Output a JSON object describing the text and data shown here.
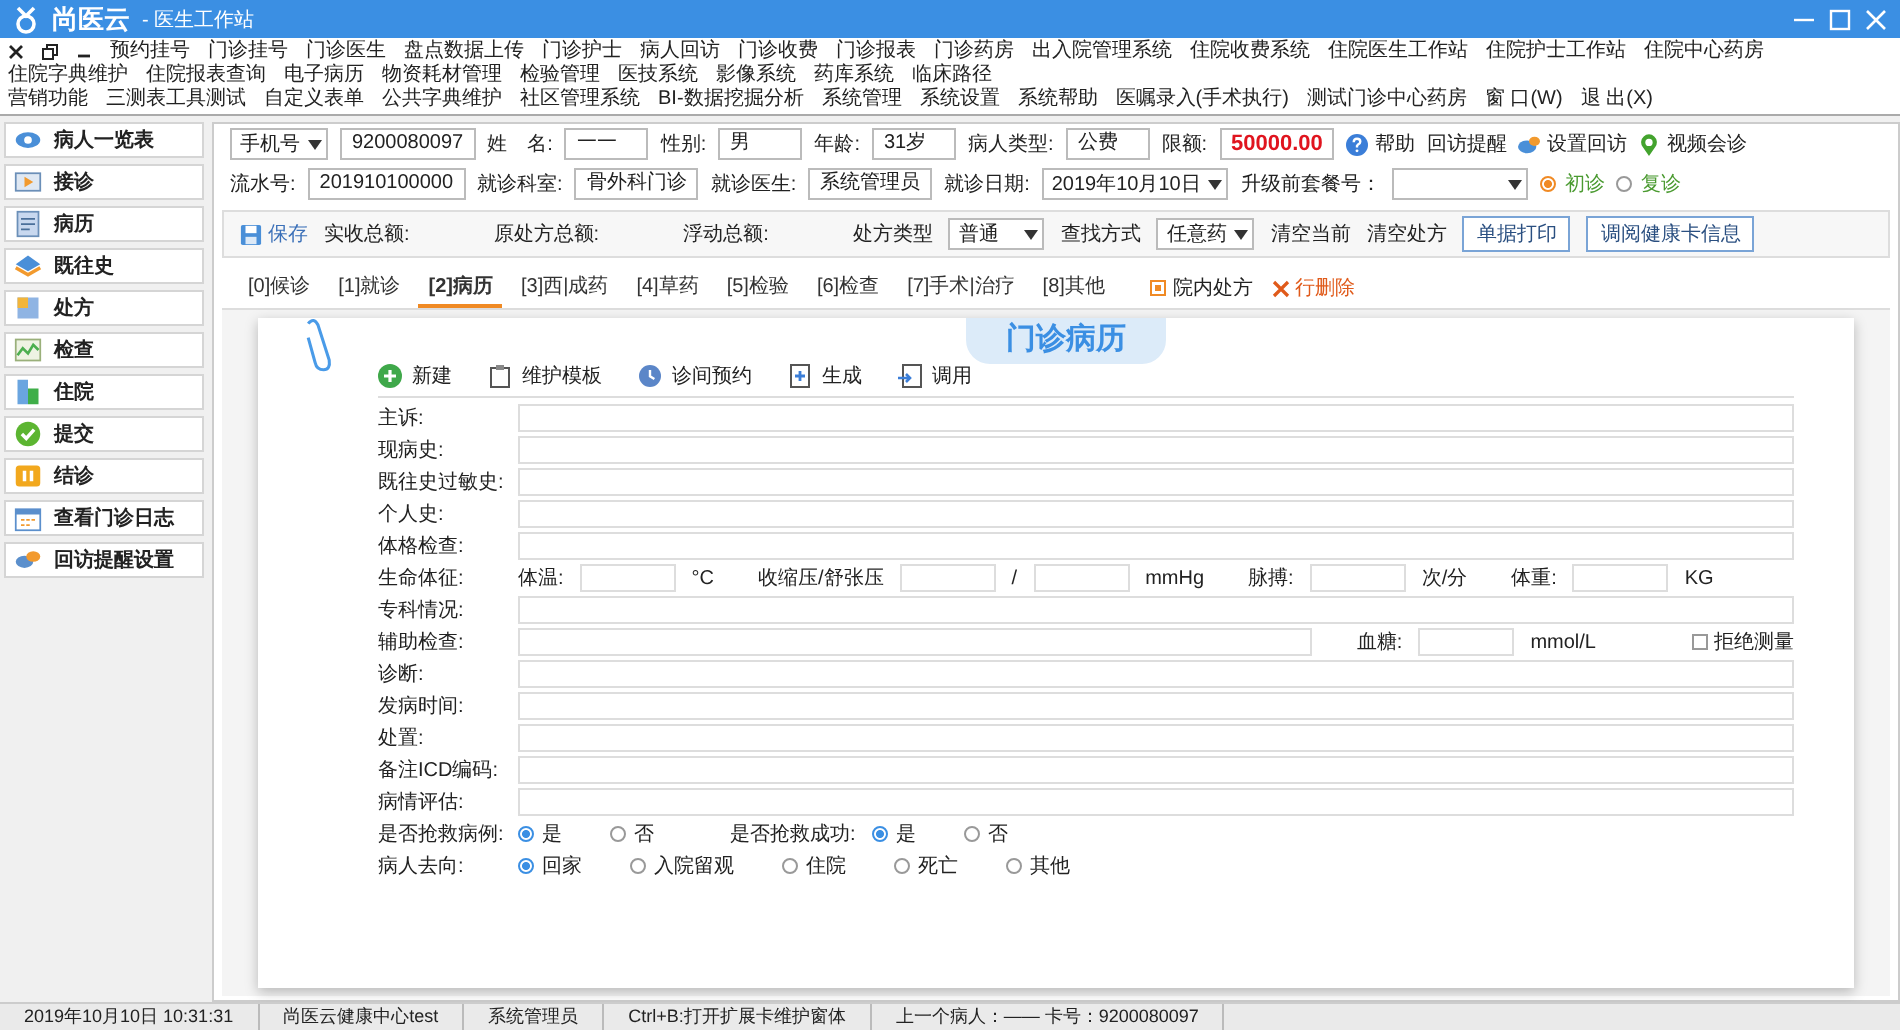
{
  "window": {
    "app_name": "尚医云",
    "title": "- 医生工作站"
  },
  "menu_rows": [
    [
      "预约挂号",
      "门诊挂号",
      "门诊医生",
      "盘点数据上传",
      "门诊护士",
      "病人回访",
      "门诊收费",
      "门诊报表",
      "门诊药房",
      "出入院管理系统",
      "住院收费系统",
      "住院医生工作站",
      "住院护士工作站",
      "住院中心药房",
      "住院字典维护",
      "住院报表查询",
      "电子病历",
      "物资耗材管理",
      "检验管理",
      "医技系统",
      "影像系统",
      "药库系统",
      "临床路径"
    ],
    [
      "营销功能",
      "三测表工具测试",
      "自定义表单",
      "公共字典维护",
      "社区管理系统",
      "BI-数据挖掘分析",
      "系统管理",
      "系统设置",
      "系统帮助",
      "医嘱录入(手术执行)",
      "测试门诊中心药房",
      "窗 口(W)",
      "退 出(X)"
    ]
  ],
  "sidebar": [
    {
      "label": "病人一览表"
    },
    {
      "label": "接诊"
    },
    {
      "label": "病历"
    },
    {
      "label": "既往史"
    },
    {
      "label": "处方"
    },
    {
      "label": "检查"
    },
    {
      "label": "住院"
    },
    {
      "label": "提交"
    },
    {
      "label": "结诊"
    },
    {
      "label": "查看门诊日志"
    },
    {
      "label": "回访提醒设置"
    }
  ],
  "patient_rows": [
    [
      {
        "kind": "select",
        "value": "手机号"
      },
      {
        "kind": "input",
        "value": "9200080097"
      },
      {
        "kind": "label",
        "text": "姓　名:"
      },
      {
        "kind": "input",
        "value": "一一"
      },
      {
        "kind": "label",
        "text": "性别:"
      },
      {
        "kind": "input",
        "value": "男"
      },
      {
        "kind": "label",
        "text": "年龄:"
      },
      {
        "kind": "input",
        "value": "31岁"
      },
      {
        "kind": "label",
        "text": "病人类型:"
      },
      {
        "kind": "input",
        "value": "公费"
      },
      {
        "kind": "label",
        "text": "限额:"
      },
      {
        "kind": "amount",
        "value": "50000.00"
      },
      {
        "kind": "help",
        "text": "帮助"
      },
      {
        "kind": "link",
        "text": "回访提醒"
      },
      {
        "kind": "revisit",
        "text": "设置回访"
      },
      {
        "kind": "video",
        "text": "视频会诊"
      }
    ],
    [
      {
        "kind": "label",
        "text": "流水号:"
      },
      {
        "kind": "input",
        "value": "201910100000"
      },
      {
        "kind": "label",
        "text": "就诊科室:"
      },
      {
        "kind": "input",
        "value": "骨外科门诊"
      },
      {
        "kind": "label",
        "text": "就诊医生:"
      },
      {
        "kind": "input",
        "value": "系统管理员"
      },
      {
        "kind": "label",
        "text": "就诊日期:"
      },
      {
        "kind": "select",
        "value": "2019年10月10日"
      },
      {
        "kind": "label",
        "text": "升级前套餐号："
      },
      {
        "kind": "select"
      },
      {
        "kind": "radio",
        "text": "初诊",
        "selected": true
      },
      {
        "kind": "radio",
        "text": "复诊",
        "selected": false
      }
    ]
  ],
  "toolbar": [
    {
      "kind": "save",
      "text": "保存"
    },
    {
      "kind": "total",
      "text": "实收总额:"
    },
    {
      "kind": "total",
      "text": "原处方总额:"
    },
    {
      "kind": "total",
      "text": "浮动总额:"
    },
    {
      "kind": "label",
      "text": "处方类型"
    },
    {
      "kind": "select",
      "value": "普通"
    },
    {
      "kind": "label",
      "text": "查找方式"
    },
    {
      "kind": "select",
      "value": "任意药"
    },
    {
      "kind": "link",
      "text": "清空当前"
    },
    {
      "kind": "link",
      "text": "清空处方"
    },
    {
      "kind": "button",
      "text": "单据打印"
    },
    {
      "kind": "button",
      "text": "调阅健康卡信息"
    }
  ],
  "tabs": [
    {
      "label": "[0]候诊",
      "selected": false
    },
    {
      "label": "[1]就诊",
      "selected": false
    },
    {
      "label": "[2]病历",
      "selected": true
    },
    {
      "label": "[3]西|成药",
      "selected": false
    },
    {
      "label": "[4]草药",
      "selected": false
    },
    {
      "label": "[5]检验",
      "selected": false
    },
    {
      "label": "[6]检查",
      "selected": false
    },
    {
      "label": "[7]手术|治疗",
      "selected": false
    },
    {
      "label": "[8]其他",
      "selected": false
    }
  ],
  "tab_tools": {
    "in_hospital": {
      "text": "院内处方",
      "checked": true
    },
    "delete_row": "行删除"
  },
  "record": {
    "title": "门诊病历",
    "actions": [
      "新建",
      "维护模板",
      "诊间预约",
      "生成",
      "调用"
    ],
    "rows": [
      {
        "label": "主诉:",
        "parts": [
          {
            "kind": "field"
          }
        ]
      },
      {
        "label": "现病史:",
        "parts": [
          {
            "kind": "field"
          }
        ]
      },
      {
        "label": "既往史过敏史:",
        "parts": [
          {
            "kind": "field"
          }
        ]
      },
      {
        "label": "个人史:",
        "parts": [
          {
            "kind": "field"
          }
        ]
      },
      {
        "label": "体格检查:",
        "parts": [
          {
            "kind": "field"
          }
        ]
      },
      {
        "label": "生命体征:",
        "parts": [
          {
            "kind": "label",
            "text": "体温:"
          },
          {
            "kind": "box"
          },
          {
            "kind": "text",
            "text": "°C"
          },
          {
            "kind": "label",
            "text": "收缩压/舒张压"
          },
          {
            "kind": "box"
          },
          {
            "kind": "text",
            "text": "/"
          },
          {
            "kind": "box"
          },
          {
            "kind": "text",
            "text": "mmHg"
          },
          {
            "kind": "label",
            "text": "脉搏:"
          },
          {
            "kind": "box"
          },
          {
            "kind": "text",
            "text": "次/分"
          },
          {
            "kind": "label",
            "text": "体重:"
          },
          {
            "kind": "box"
          },
          {
            "kind": "text",
            "text": "KG"
          }
        ]
      },
      {
        "label": "专科情况:",
        "parts": [
          {
            "kind": "field"
          }
        ]
      },
      {
        "label": "辅助检查:",
        "parts": [
          {
            "kind": "field"
          },
          {
            "kind": "label",
            "text": "血糖:"
          },
          {
            "kind": "box"
          },
          {
            "kind": "text",
            "text": "mmol/L"
          },
          {
            "kind": "checkbox",
            "text": "拒绝测量",
            "checked": false
          }
        ]
      },
      {
        "label": "诊断:",
        "parts": [
          {
            "kind": "field"
          }
        ]
      },
      {
        "label": "发病时间:",
        "parts": [
          {
            "kind": "field"
          }
        ]
      },
      {
        "label": "处置:",
        "parts": [
          {
            "kind": "field"
          }
        ]
      },
      {
        "label": "备注ICD编码:",
        "parts": [
          {
            "kind": "field"
          }
        ]
      },
      {
        "label": "病情评估:",
        "parts": [
          {
            "kind": "field"
          }
        ]
      },
      {
        "label": "是否抢救病例:",
        "parts": [
          {
            "kind": "radio",
            "text": "是",
            "selected": true
          },
          {
            "kind": "radio",
            "text": "否",
            "selected": false
          },
          {
            "kind": "label",
            "text": "是否抢救成功:"
          },
          {
            "kind": "radio",
            "text": "是",
            "selected": true
          },
          {
            "kind": "radio",
            "text": "否",
            "selected": false
          }
        ]
      },
      {
        "label": "病人去向:",
        "parts": [
          {
            "kind": "radio",
            "text": "回家",
            "selected": true
          },
          {
            "kind": "radio",
            "text": "入院留观",
            "selected": false
          },
          {
            "kind": "radio",
            "text": "住院",
            "selected": false
          },
          {
            "kind": "radio",
            "text": "死亡",
            "selected": false
          },
          {
            "kind": "radio",
            "text": "其他",
            "selected": false
          }
        ]
      }
    ]
  },
  "status_bar": [
    "2019年10月10日 10:31:31",
    "尚医云健康中心test",
    "系统管理员",
    "Ctrl+B:打开扩展卡维护窗体",
    "上一个病人：—— 卡号：9200080097"
  ]
}
